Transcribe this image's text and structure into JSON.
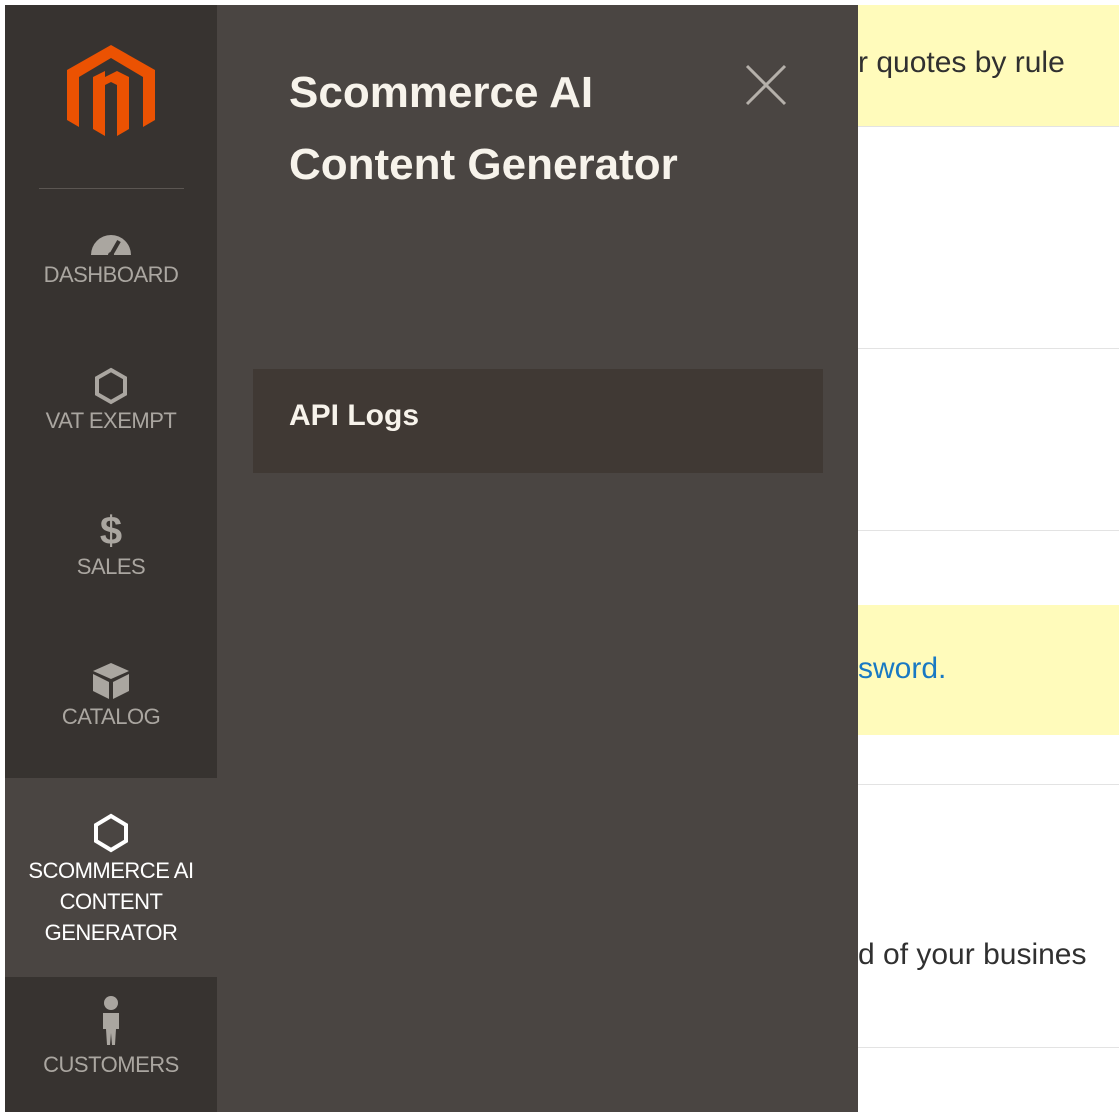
{
  "sidebar": {
    "items": [
      {
        "label": "DASHBOARD",
        "icon": "dashboard-gauge-icon"
      },
      {
        "label": "VAT EXEMPT",
        "icon": "hexagon-icon"
      },
      {
        "label": "SALES",
        "icon": "dollar-icon"
      },
      {
        "label": "CATALOG",
        "icon": "box-icon"
      },
      {
        "label": "SCOMMERCE AI\nCONTENT\nGENERATOR",
        "icon": "hexagon-icon",
        "active": true
      },
      {
        "label": "CUSTOMERS",
        "icon": "person-icon"
      }
    ]
  },
  "flyout": {
    "title": "Scommerce AI Content Generator",
    "items": [
      {
        "label": "API Logs"
      }
    ]
  },
  "main": {
    "messages": [
      "r quotes by rule",
      "sword.",
      "d of your busines"
    ]
  },
  "colors": {
    "brand_orange": "#eb5202",
    "nav_bg": "#373330",
    "flyout_bg": "#4a4542",
    "notice_bg": "#fffbbb",
    "link": "#1979c3"
  }
}
